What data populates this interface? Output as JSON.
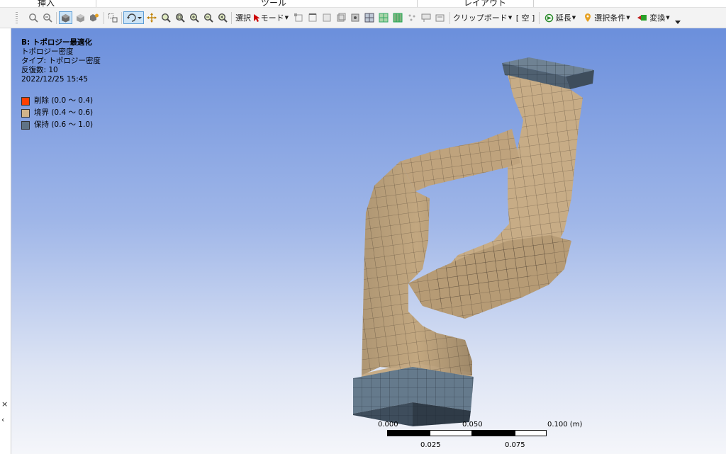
{
  "ribbon_groups": [
    "挿入",
    "ツール",
    "レイアウト"
  ],
  "toolbar": {
    "select_label": "選択",
    "mode_label": "モード",
    "clipboard_label": "クリップボード",
    "empty_label": "[ 空 ]",
    "extend_label": "延長",
    "selection_condition_label": "選択条件",
    "convert_label": "変換"
  },
  "side_panel": {
    "close_glyph": "×",
    "expand_glyph": "‹"
  },
  "info": {
    "title": "B: トポロジー最適化",
    "subtitle": "トポロジー密度",
    "type_line": "タイプ: トポロジー密度",
    "iterations": "反復数: 10",
    "timestamp": "2022/12/25 15:45"
  },
  "legend": [
    {
      "label": "削除 (0.0 ～ 0.4)",
      "color": "#ff4000"
    },
    {
      "label": "境界 (0.4 ～ 0.6)",
      "color": "#d1b48a"
    },
    {
      "label": "保持 (0.6 ～ 1.0)",
      "color": "#5f7385"
    }
  ],
  "colors": {
    "boundary": "#c7ac86",
    "boundary_dark": "#a88d69",
    "keep": "#5d6f80",
    "keep_dark": "#3e4d5c"
  },
  "scale_bar": {
    "labels_top": [
      "0.000",
      "0.050",
      "0.100 (m)"
    ],
    "labels_bottom": [
      "0.025",
      "0.075"
    ]
  }
}
